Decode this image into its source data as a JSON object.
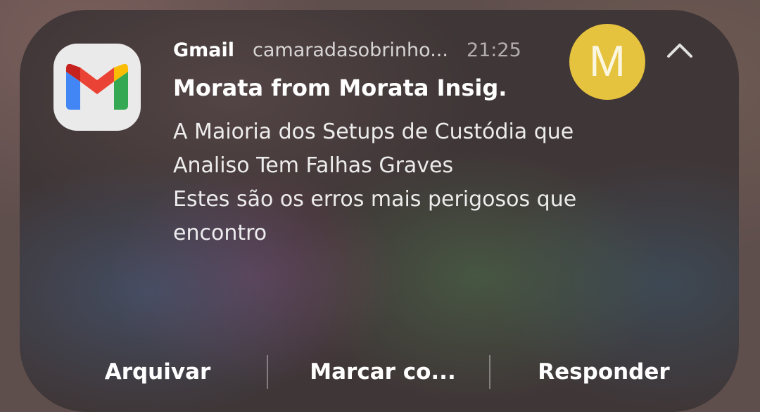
{
  "notification": {
    "app_name": "Gmail",
    "account": "camaradasobrinho...",
    "time": "21:25",
    "avatar_letter": "M",
    "avatar_color": "#e6c33f",
    "sender": "Morata from Morata Insig.",
    "subject_line1": "A Maioria dos Setups de Custódia que",
    "subject_line2": "Analiso Tem Falhas Graves",
    "preview_line1": "Estes são os erros mais perigosos que",
    "preview_line2": "encontro",
    "icons": {
      "app": "gmail-icon",
      "collapse": "chevron-up-icon"
    }
  },
  "actions": {
    "archive": "Arquivar",
    "mark": "Marcar co...",
    "reply": "Responder"
  }
}
